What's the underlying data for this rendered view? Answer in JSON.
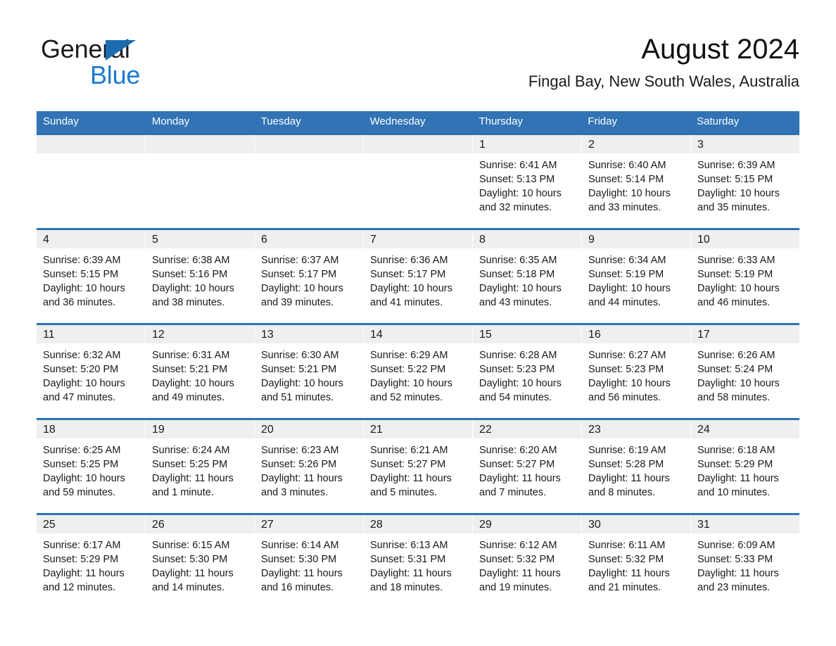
{
  "brand": {
    "word_one": "General",
    "word_two": "Blue",
    "triangle_color": "#1b6cb0",
    "blue_color": "#1b7ad1"
  },
  "header": {
    "title": "August 2024",
    "subtitle": "Fingal Bay, New South Wales, Australia"
  },
  "theme": {
    "header_blue": "#3173b5",
    "rule_blue": "#2f72b4",
    "date_band_gray": "#efefef"
  },
  "weekdays": [
    "Sunday",
    "Monday",
    "Tuesday",
    "Wednesday",
    "Thursday",
    "Friday",
    "Saturday"
  ],
  "weeks": [
    [
      {
        "date": "",
        "lines": []
      },
      {
        "date": "",
        "lines": []
      },
      {
        "date": "",
        "lines": []
      },
      {
        "date": "",
        "lines": []
      },
      {
        "date": "1",
        "lines": [
          "Sunrise: 6:41 AM",
          "Sunset: 5:13 PM",
          "Daylight: 10 hours and 32 minutes."
        ]
      },
      {
        "date": "2",
        "lines": [
          "Sunrise: 6:40 AM",
          "Sunset: 5:14 PM",
          "Daylight: 10 hours and 33 minutes."
        ]
      },
      {
        "date": "3",
        "lines": [
          "Sunrise: 6:39 AM",
          "Sunset: 5:15 PM",
          "Daylight: 10 hours and 35 minutes."
        ]
      }
    ],
    [
      {
        "date": "4",
        "lines": [
          "Sunrise: 6:39 AM",
          "Sunset: 5:15 PM",
          "Daylight: 10 hours and 36 minutes."
        ]
      },
      {
        "date": "5",
        "lines": [
          "Sunrise: 6:38 AM",
          "Sunset: 5:16 PM",
          "Daylight: 10 hours and 38 minutes."
        ]
      },
      {
        "date": "6",
        "lines": [
          "Sunrise: 6:37 AM",
          "Sunset: 5:17 PM",
          "Daylight: 10 hours and 39 minutes."
        ]
      },
      {
        "date": "7",
        "lines": [
          "Sunrise: 6:36 AM",
          "Sunset: 5:17 PM",
          "Daylight: 10 hours and 41 minutes."
        ]
      },
      {
        "date": "8",
        "lines": [
          "Sunrise: 6:35 AM",
          "Sunset: 5:18 PM",
          "Daylight: 10 hours and 43 minutes."
        ]
      },
      {
        "date": "9",
        "lines": [
          "Sunrise: 6:34 AM",
          "Sunset: 5:19 PM",
          "Daylight: 10 hours and 44 minutes."
        ]
      },
      {
        "date": "10",
        "lines": [
          "Sunrise: 6:33 AM",
          "Sunset: 5:19 PM",
          "Daylight: 10 hours and 46 minutes."
        ]
      }
    ],
    [
      {
        "date": "11",
        "lines": [
          "Sunrise: 6:32 AM",
          "Sunset: 5:20 PM",
          "Daylight: 10 hours and 47 minutes."
        ]
      },
      {
        "date": "12",
        "lines": [
          "Sunrise: 6:31 AM",
          "Sunset: 5:21 PM",
          "Daylight: 10 hours and 49 minutes."
        ]
      },
      {
        "date": "13",
        "lines": [
          "Sunrise: 6:30 AM",
          "Sunset: 5:21 PM",
          "Daylight: 10 hours and 51 minutes."
        ]
      },
      {
        "date": "14",
        "lines": [
          "Sunrise: 6:29 AM",
          "Sunset: 5:22 PM",
          "Daylight: 10 hours and 52 minutes."
        ]
      },
      {
        "date": "15",
        "lines": [
          "Sunrise: 6:28 AM",
          "Sunset: 5:23 PM",
          "Daylight: 10 hours and 54 minutes."
        ]
      },
      {
        "date": "16",
        "lines": [
          "Sunrise: 6:27 AM",
          "Sunset: 5:23 PM",
          "Daylight: 10 hours and 56 minutes."
        ]
      },
      {
        "date": "17",
        "lines": [
          "Sunrise: 6:26 AM",
          "Sunset: 5:24 PM",
          "Daylight: 10 hours and 58 minutes."
        ]
      }
    ],
    [
      {
        "date": "18",
        "lines": [
          "Sunrise: 6:25 AM",
          "Sunset: 5:25 PM",
          "Daylight: 10 hours and 59 minutes."
        ]
      },
      {
        "date": "19",
        "lines": [
          "Sunrise: 6:24 AM",
          "Sunset: 5:25 PM",
          "Daylight: 11 hours and 1 minute."
        ]
      },
      {
        "date": "20",
        "lines": [
          "Sunrise: 6:23 AM",
          "Sunset: 5:26 PM",
          "Daylight: 11 hours and 3 minutes."
        ]
      },
      {
        "date": "21",
        "lines": [
          "Sunrise: 6:21 AM",
          "Sunset: 5:27 PM",
          "Daylight: 11 hours and 5 minutes."
        ]
      },
      {
        "date": "22",
        "lines": [
          "Sunrise: 6:20 AM",
          "Sunset: 5:27 PM",
          "Daylight: 11 hours and 7 minutes."
        ]
      },
      {
        "date": "23",
        "lines": [
          "Sunrise: 6:19 AM",
          "Sunset: 5:28 PM",
          "Daylight: 11 hours and 8 minutes."
        ]
      },
      {
        "date": "24",
        "lines": [
          "Sunrise: 6:18 AM",
          "Sunset: 5:29 PM",
          "Daylight: 11 hours and 10 minutes."
        ]
      }
    ],
    [
      {
        "date": "25",
        "lines": [
          "Sunrise: 6:17 AM",
          "Sunset: 5:29 PM",
          "Daylight: 11 hours and 12 minutes."
        ]
      },
      {
        "date": "26",
        "lines": [
          "Sunrise: 6:15 AM",
          "Sunset: 5:30 PM",
          "Daylight: 11 hours and 14 minutes."
        ]
      },
      {
        "date": "27",
        "lines": [
          "Sunrise: 6:14 AM",
          "Sunset: 5:30 PM",
          "Daylight: 11 hours and 16 minutes."
        ]
      },
      {
        "date": "28",
        "lines": [
          "Sunrise: 6:13 AM",
          "Sunset: 5:31 PM",
          "Daylight: 11 hours and 18 minutes."
        ]
      },
      {
        "date": "29",
        "lines": [
          "Sunrise: 6:12 AM",
          "Sunset: 5:32 PM",
          "Daylight: 11 hours and 19 minutes."
        ]
      },
      {
        "date": "30",
        "lines": [
          "Sunrise: 6:11 AM",
          "Sunset: 5:32 PM",
          "Daylight: 11 hours and 21 minutes."
        ]
      },
      {
        "date": "31",
        "lines": [
          "Sunrise: 6:09 AM",
          "Sunset: 5:33 PM",
          "Daylight: 11 hours and 23 minutes."
        ]
      }
    ]
  ]
}
